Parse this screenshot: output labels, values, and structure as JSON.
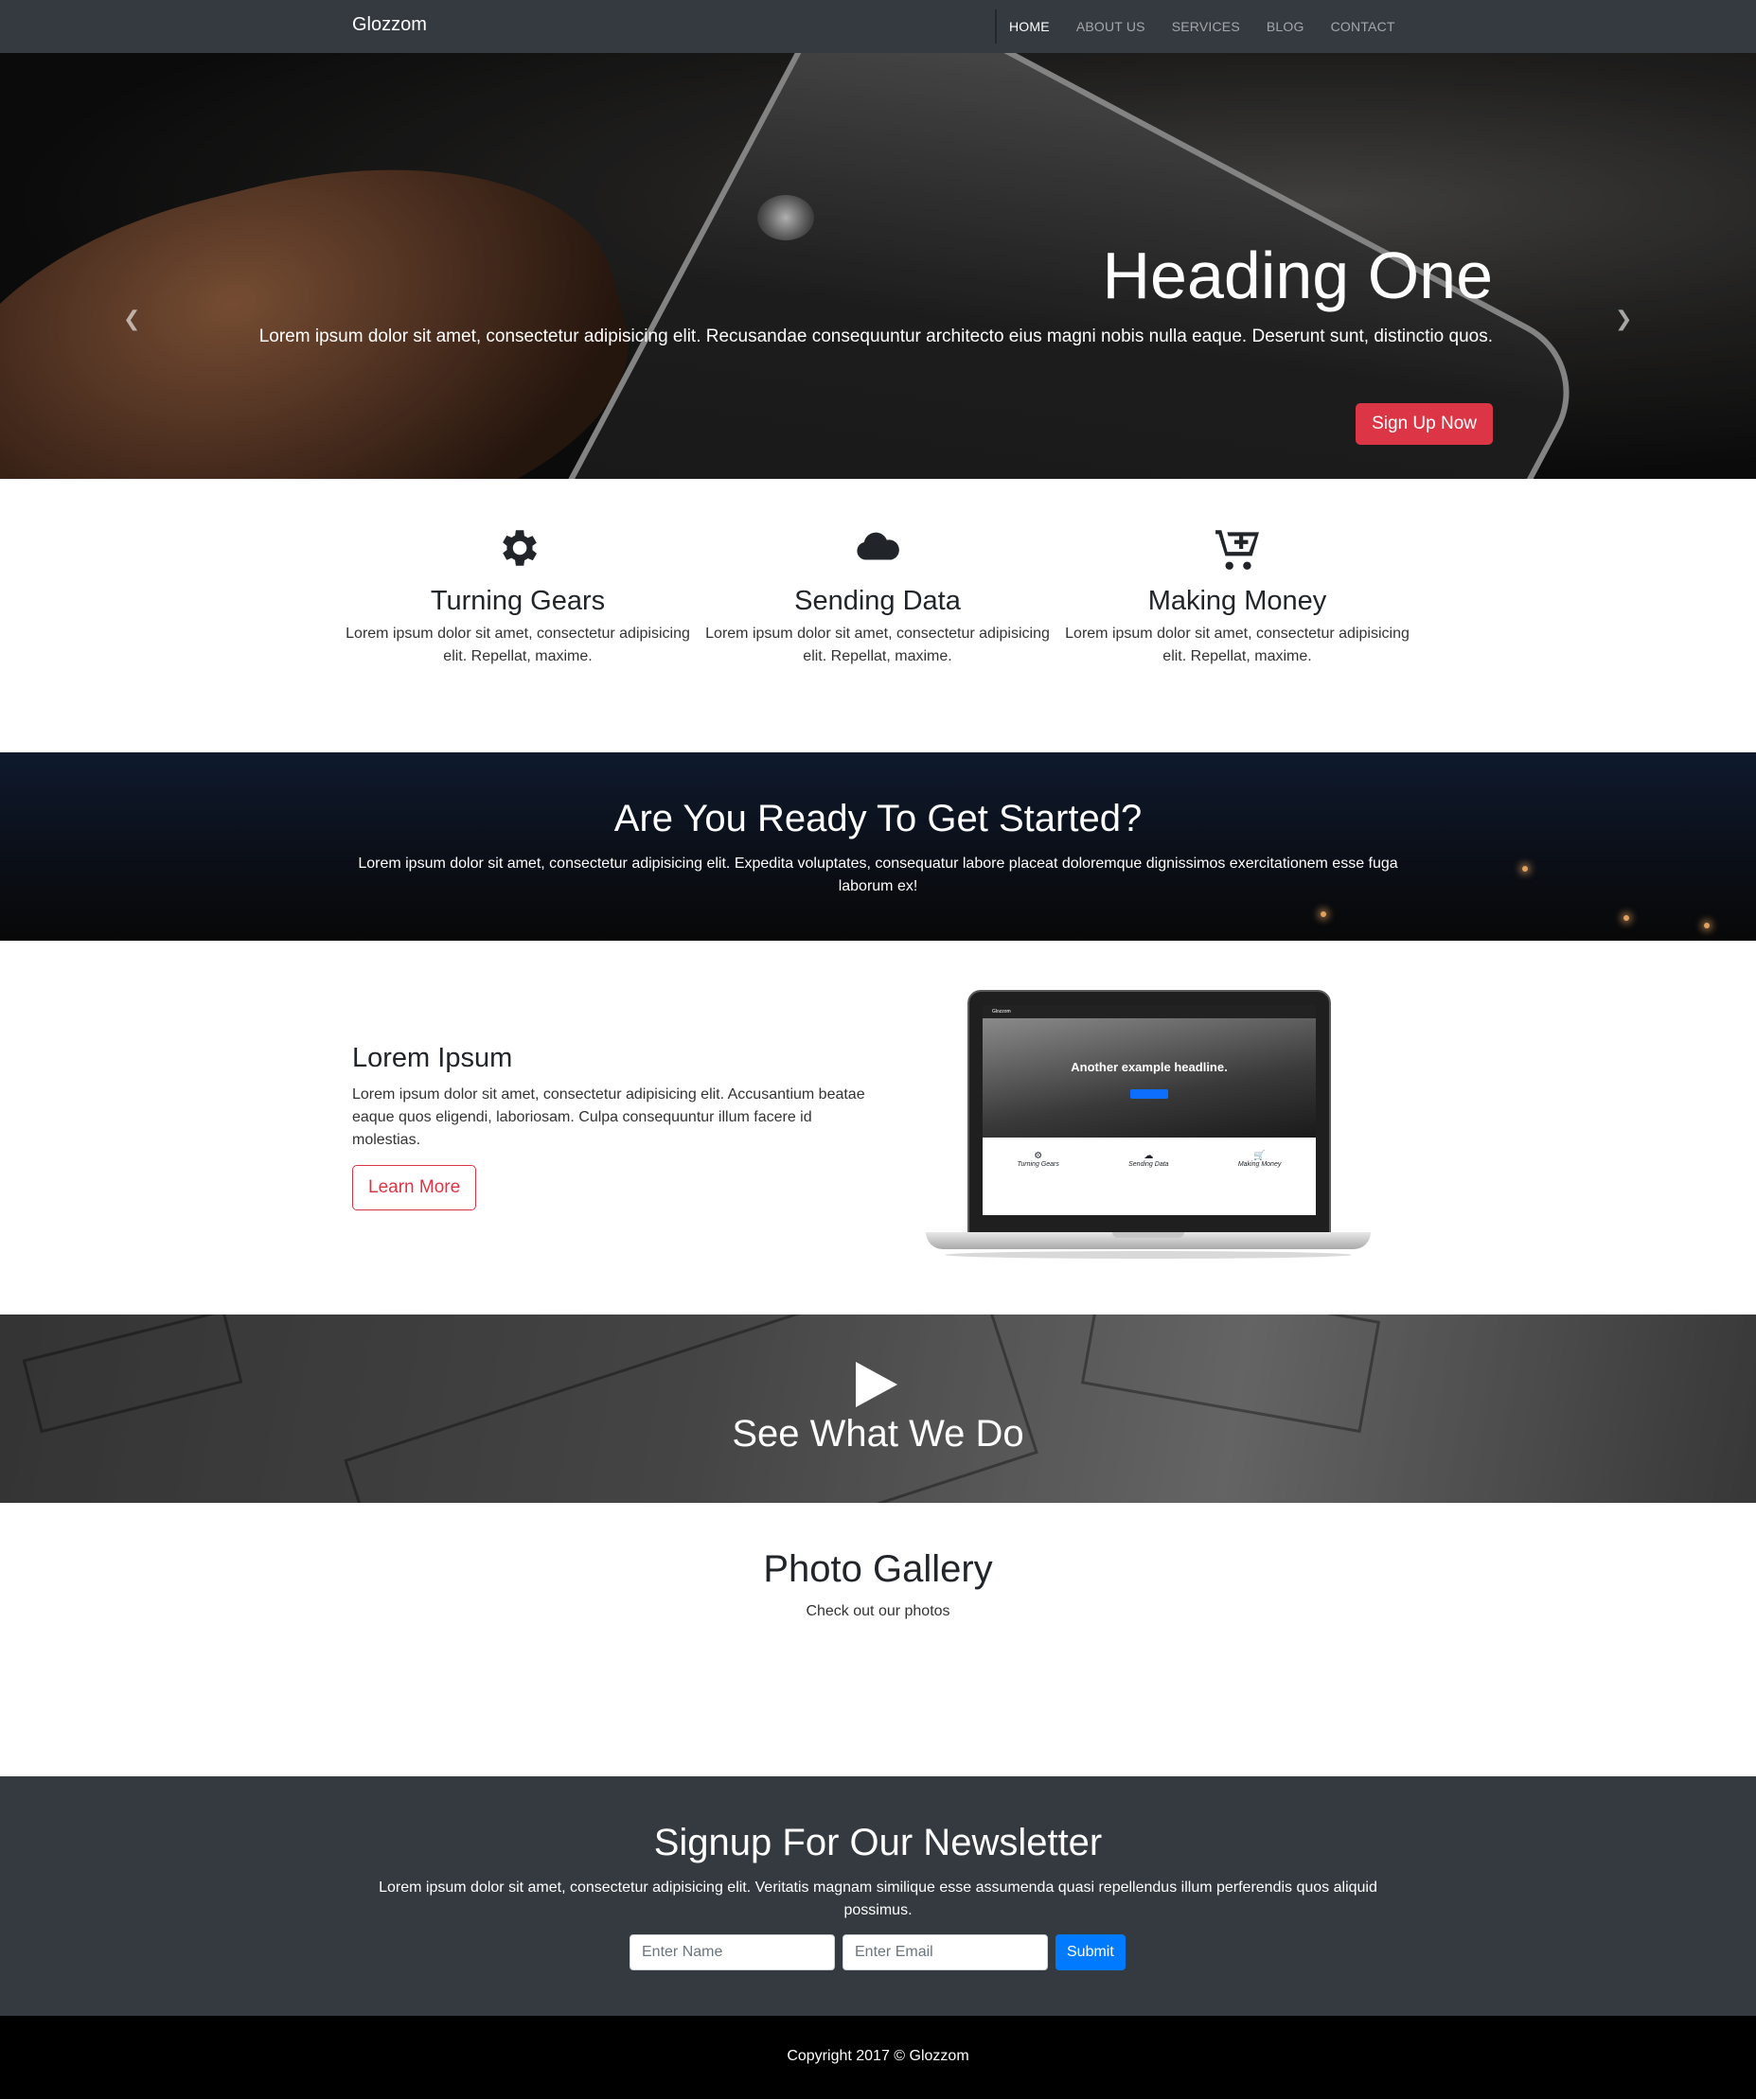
{
  "nav": {
    "brand": "Glozzom",
    "items": [
      {
        "label": "HOME",
        "active": true
      },
      {
        "label": "ABOUT US"
      },
      {
        "label": "SERVICES"
      },
      {
        "label": "BLOG"
      },
      {
        "label": "CONTACT"
      }
    ]
  },
  "hero": {
    "title": "Heading One",
    "text": "Lorem ipsum dolor sit amet, consectetur adipisicing elit. Recusandae consequuntur architecto eius magni nobis nulla eaque. Deserunt sunt, distinctio quos.",
    "button": "Sign Up Now",
    "slides": 3,
    "active_slide": 1
  },
  "features": [
    {
      "icon": "gear-icon",
      "title": "Turning Gears",
      "text": "Lorem ipsum dolor sit amet, consectetur adipisicing elit. Repellat, maxime."
    },
    {
      "icon": "cloud-icon",
      "title": "Sending Data",
      "text": "Lorem ipsum dolor sit amet, consectetur adipisicing elit. Repellat, maxime."
    },
    {
      "icon": "cart-plus-icon",
      "title": "Making Money",
      "text": "Lorem ipsum dolor sit amet, consectetur adipisicing elit. Repellat, maxime."
    }
  ],
  "ready": {
    "title": "Are You Ready To Get Started?",
    "text": "Lorem ipsum dolor sit amet, consectetur adipisicing elit. Expedita voluptates, consequatur labore placeat doloremque dignissimos exercitationem esse fuga laborum ex!"
  },
  "lorem": {
    "title": "Lorem Ipsum",
    "text": "Lorem ipsum dolor sit amet, consectetur adipisicing elit. Accusantium beatae eaque quos eligendi, laboriosam. Culpa consequuntur illum facere id molestias.",
    "button": "Learn More",
    "laptop": {
      "brand": "Glozzom",
      "headline": "Another example headline.",
      "features": [
        "Turning Gears",
        "Sending Data",
        "Making Money"
      ]
    }
  },
  "video": {
    "title": "See What We Do"
  },
  "gallery": {
    "title": "Photo Gallery",
    "subtitle": "Check out our photos"
  },
  "newsletter": {
    "title": "Signup For Our Newsletter",
    "text": "Lorem ipsum dolor sit amet, consectetur adipisicing elit. Veritatis magnam similique esse assumenda quasi repellendus illum perferendis quos aliquid possimus.",
    "name_placeholder": "Enter Name",
    "email_placeholder": "Enter Email",
    "submit": "Submit"
  },
  "footer": {
    "text": "Copyright 2017 © Glozzom"
  },
  "colors": {
    "navbar": "#343a40",
    "danger": "#dc3545",
    "primary": "#007bff",
    "footer": "#000000"
  }
}
